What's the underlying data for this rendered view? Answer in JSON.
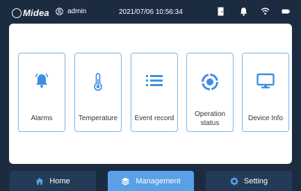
{
  "status_bar": {
    "brand": "Midea",
    "user": "admin",
    "datetime": "2021/07/06  10:56:34",
    "icons": [
      "door-icon",
      "bell-icon",
      "wifi-icon",
      "battery-icon"
    ]
  },
  "cards": [
    {
      "label": "Alarms",
      "icon": "bell-icon"
    },
    {
      "label": "Temperature",
      "icon": "thermometer-icon"
    },
    {
      "label": "Event record",
      "icon": "list-icon"
    },
    {
      "label": "Operation status",
      "icon": "status-ring-icon"
    },
    {
      "label": "Device Info",
      "icon": "monitor-icon"
    }
  ],
  "nav": {
    "home": "Home",
    "management": "Management",
    "setting": "Setting",
    "active": "management"
  },
  "colors": {
    "background": "#1c2c40",
    "accent": "#5aa0e6",
    "card_border": "#7fb2e6",
    "icon": "#3d8fe0"
  }
}
